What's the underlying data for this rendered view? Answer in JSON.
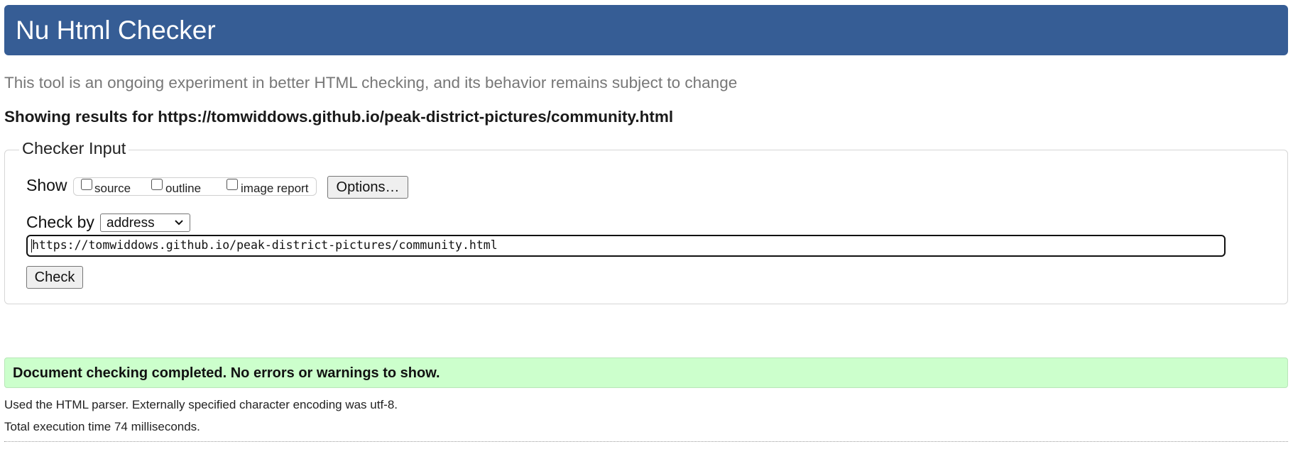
{
  "header": {
    "title": "Nu Html Checker"
  },
  "intro": "This tool is an ongoing experiment in better HTML checking, and its behavior remains subject to change",
  "showing_results": "Showing results for https://tomwiddows.github.io/peak-district-pictures/community.html",
  "checker_input": {
    "legend": "Checker Input",
    "show_label": "Show",
    "show_options": [
      {
        "label": "source",
        "checked": false
      },
      {
        "label": "outline",
        "checked": false
      },
      {
        "label": "image report",
        "checked": false
      }
    ],
    "options_button": "Options…",
    "check_by_label": "Check by",
    "check_by_selected": "address",
    "url_value": "https://tomwiddows.github.io/peak-district-pictures/community.html",
    "check_button": "Check"
  },
  "result": {
    "message": "Document checking completed. No errors or warnings to show.",
    "status_color": "#ccffcc"
  },
  "details": {
    "parser": "Used the HTML parser. Externally specified character encoding was utf-8.",
    "execution_time": "Total execution time 74 milliseconds."
  },
  "colors": {
    "header_bg": "#365d95",
    "success_bg": "#ccffcc"
  },
  "icons": {
    "select_arrow": "chevron-down-icon"
  }
}
